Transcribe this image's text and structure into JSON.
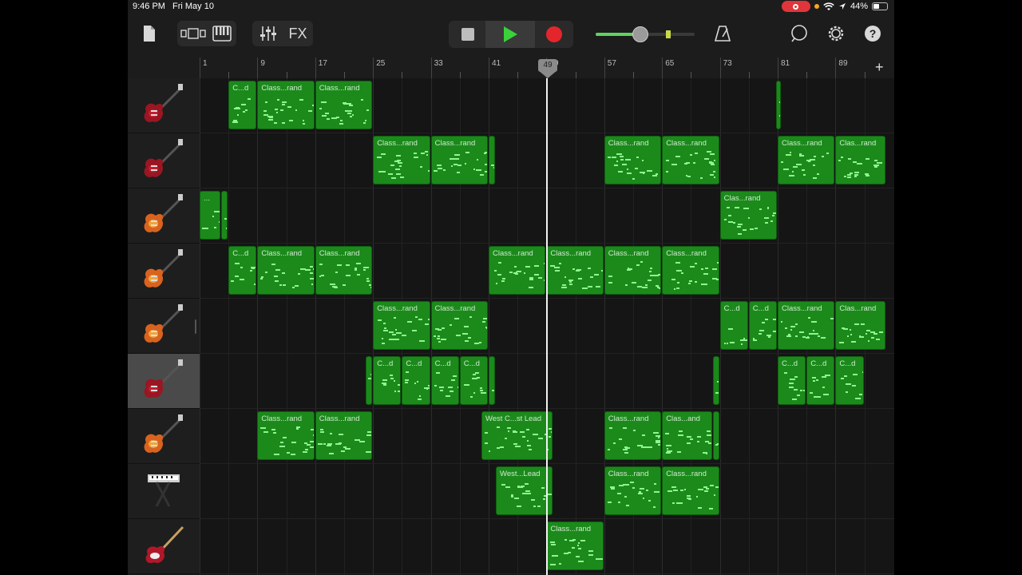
{
  "status_bar": {
    "time": "9:46 PM",
    "date": "Fri May 10",
    "battery": "44%",
    "battery_level": 0.44
  },
  "toolbar": {
    "fx_label": "FX",
    "icons": [
      "document-icon",
      "tracks-view-icon",
      "keyboard-icon",
      "mixer-icon",
      "metronome-icon",
      "loop-icon",
      "settings-icon",
      "help-icon"
    ],
    "volume_level": 0.45
  },
  "ruler": {
    "bars": [
      "1",
      "9",
      "17",
      "25",
      "33",
      "41",
      "49",
      "57",
      "65",
      "73",
      "81",
      "89"
    ],
    "playhead_bar": "49"
  },
  "colors": {
    "region": "#1b8a1b",
    "notes": "#8ff58f",
    "record": "#e4262c",
    "play": "#3bd13b"
  },
  "tracks": [
    {
      "instrument": "red-electric-guitar-icon",
      "regions": [
        {
          "label": "C...d",
          "start": 5,
          "end": 9
        },
        {
          "label": "Class...rand",
          "start": 9,
          "end": 17
        },
        {
          "label": "Class...rand",
          "start": 17,
          "end": 25
        },
        {
          "label": "",
          "start": 80.8,
          "end": 81.6
        }
      ]
    },
    {
      "instrument": "red-electric-guitar-icon",
      "regions": [
        {
          "label": "Class...rand",
          "start": 25,
          "end": 33
        },
        {
          "label": "Class...rand",
          "start": 33,
          "end": 41
        },
        {
          "label": "",
          "start": 41,
          "end": 42
        },
        {
          "label": "Class...rand",
          "start": 57,
          "end": 65
        },
        {
          "label": "Class...rand",
          "start": 65,
          "end": 73
        },
        {
          "label": "Class...rand",
          "start": 81,
          "end": 89
        },
        {
          "label": "Clas...rand",
          "start": 89,
          "end": 96
        }
      ]
    },
    {
      "instrument": "sunburst-guitar-icon",
      "regions": [
        {
          "label": "...",
          "start": 1,
          "end": 4
        },
        {
          "label": "",
          "start": 4,
          "end": 5
        },
        {
          "label": "Clas...rand",
          "start": 73,
          "end": 81
        }
      ]
    },
    {
      "instrument": "sunburst-guitar-icon",
      "regions": [
        {
          "label": "C...d",
          "start": 5,
          "end": 9
        },
        {
          "label": "Class...rand",
          "start": 9,
          "end": 17
        },
        {
          "label": "Class...rand",
          "start": 17,
          "end": 25
        },
        {
          "label": "Class...rand",
          "start": 41,
          "end": 49
        },
        {
          "label": "Class...rand",
          "start": 49,
          "end": 57
        },
        {
          "label": "Class...rand",
          "start": 57,
          "end": 65
        },
        {
          "label": "Class...rand",
          "start": 65,
          "end": 73
        }
      ]
    },
    {
      "instrument": "sunburst-guitar-icon",
      "regions": [
        {
          "label": "Class...rand",
          "start": 25,
          "end": 33
        },
        {
          "label": "Class...rand",
          "start": 33,
          "end": 41
        },
        {
          "label": "C...d",
          "start": 73,
          "end": 77
        },
        {
          "label": "C...d",
          "start": 77,
          "end": 81
        },
        {
          "label": "Class...rand",
          "start": 81,
          "end": 89
        },
        {
          "label": "Clas...rand",
          "start": 89,
          "end": 96
        }
      ]
    },
    {
      "instrument": "red-electric-guitar-icon",
      "selected": true,
      "regions": [
        {
          "label": "",
          "start": 24,
          "end": 25
        },
        {
          "label": "C...d",
          "start": 25,
          "end": 29
        },
        {
          "label": "C...d",
          "start": 29,
          "end": 33
        },
        {
          "label": "C...d",
          "start": 33,
          "end": 37
        },
        {
          "label": "C...d",
          "start": 37,
          "end": 41
        },
        {
          "label": "",
          "start": 41,
          "end": 42
        },
        {
          "label": "",
          "start": 72,
          "end": 73
        },
        {
          "label": "C...d",
          "start": 81,
          "end": 85
        },
        {
          "label": "C...d",
          "start": 85,
          "end": 89
        },
        {
          "label": "C...d",
          "start": 89,
          "end": 93
        }
      ]
    },
    {
      "instrument": "sunburst-guitar-icon",
      "regions": [
        {
          "label": "Class...rand",
          "start": 9,
          "end": 17
        },
        {
          "label": "Class...rand",
          "start": 17,
          "end": 25
        },
        {
          "label": "West C...st Lead",
          "start": 40,
          "end": 50
        },
        {
          "label": "Class...rand",
          "start": 57,
          "end": 65
        },
        {
          "label": "Clas...and",
          "start": 65,
          "end": 72
        },
        {
          "label": "",
          "start": 72,
          "end": 73
        }
      ]
    },
    {
      "instrument": "synth-keyboard-icon",
      "regions": [
        {
          "label": "West...Lead",
          "start": 42,
          "end": 50
        },
        {
          "label": "Class...rand",
          "start": 57,
          "end": 65
        },
        {
          "label": "Class...rand",
          "start": 65,
          "end": 73
        }
      ]
    },
    {
      "instrument": "bass-guitar-icon",
      "regions": [
        {
          "label": "Class...rand",
          "start": 49,
          "end": 57
        }
      ]
    }
  ]
}
